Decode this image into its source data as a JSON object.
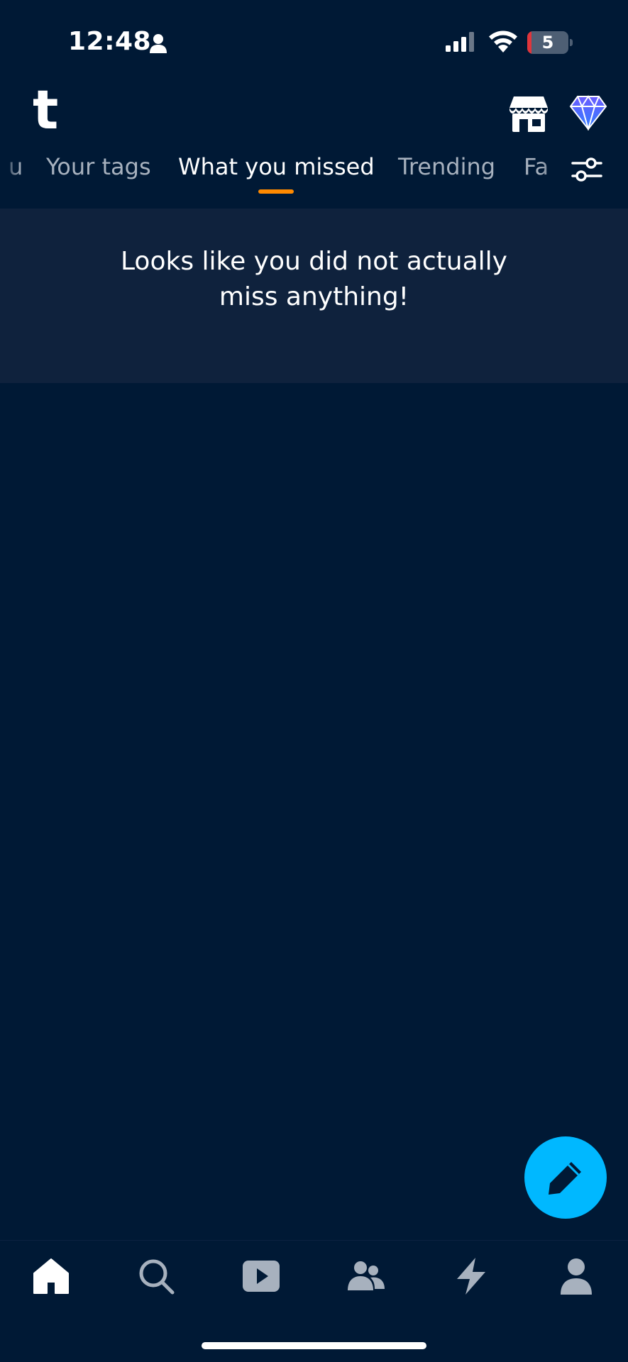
{
  "status_bar": {
    "time": "12:48",
    "battery_level": "5",
    "battery_fraction": 0.05
  },
  "header": {
    "logo": "t",
    "icons": [
      "shop-icon",
      "gem-icon"
    ]
  },
  "tabs": [
    {
      "label": "u",
      "active": false
    },
    {
      "label": "Your tags",
      "active": false
    },
    {
      "label": "What you missed",
      "active": true
    },
    {
      "label": "Trending",
      "active": false
    },
    {
      "label": "Fa",
      "active": false
    }
  ],
  "notice": {
    "message": "Looks like you did not actually miss anything!"
  },
  "bottom_nav": {
    "items": [
      "home-icon",
      "search-icon",
      "video-icon",
      "communities-icon",
      "activity-icon",
      "account-icon"
    ],
    "active": "home-icon"
  },
  "colors": {
    "background": "#001935",
    "notice_background": "#0f223d",
    "accent": "#ff8a00",
    "compose": "#00b8ff",
    "inactive": "#a7b1be"
  }
}
